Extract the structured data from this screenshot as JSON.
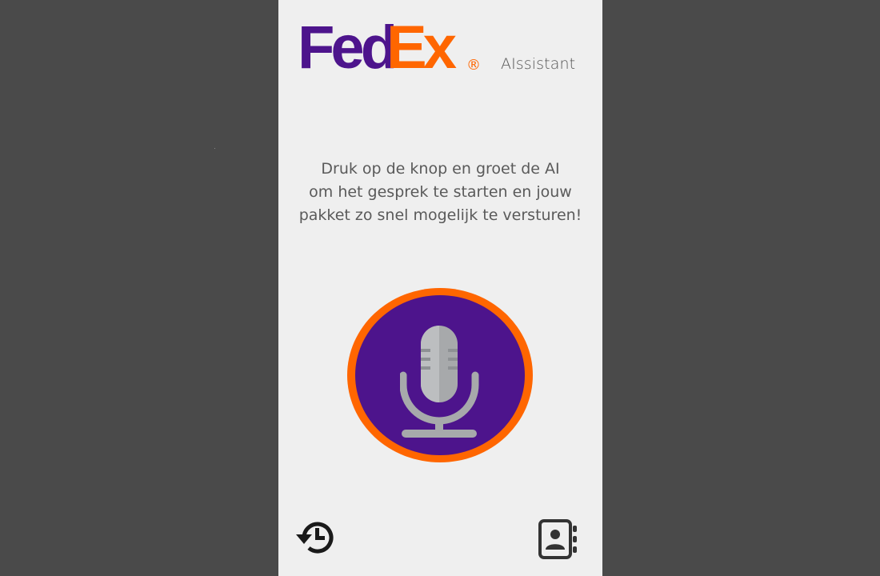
{
  "brand": {
    "logo_text_fed": "Fed",
    "logo_text_ex": "Ex",
    "logo_registered": "®",
    "purple": "#4d148c",
    "orange": "#ff6600",
    "assistant_label": "AIssistant"
  },
  "instruction": {
    "line1": "Druk op de knop en groet de AI",
    "line2": "om het gesprek te starten en jouw",
    "line3": "pakket zo snel mogelijk te versturen!"
  },
  "controls": {
    "mic_icon": "microphone-icon",
    "history_icon": "history-icon",
    "contacts_icon": "address-book-icon"
  }
}
